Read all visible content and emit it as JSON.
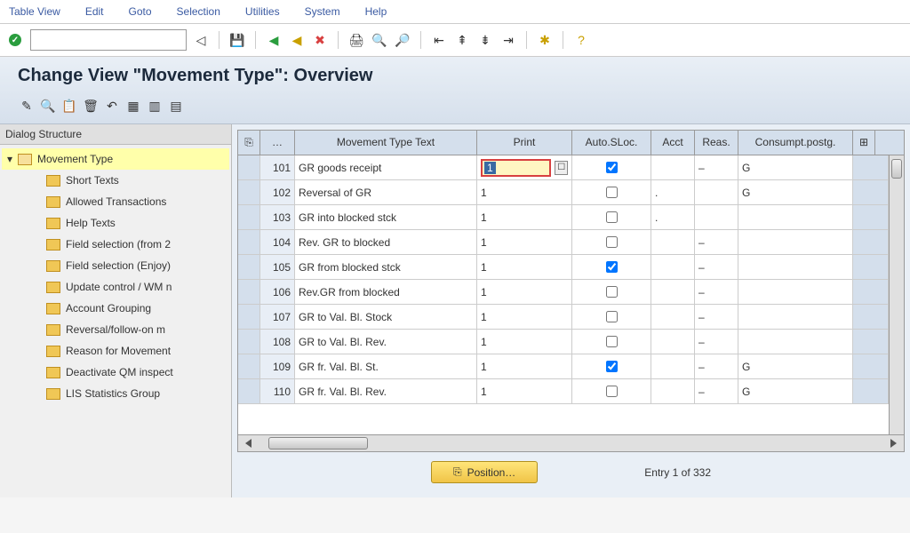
{
  "menu": [
    "Table View",
    "Edit",
    "Goto",
    "Selection",
    "Utilities",
    "System",
    "Help"
  ],
  "page_title": "Change View \"Movement Type\": Overview",
  "tree_header": "Dialog Structure",
  "tree": {
    "root": "Movement Type",
    "children": [
      "Short Texts",
      "Allowed Transactions",
      "Help Texts",
      "Field selection (from 2",
      "Field selection (Enjoy)",
      "Update control / WM n",
      "Account Grouping",
      "Reversal/follow-on m",
      "Reason for Movement",
      "Deactivate QM inspect",
      "LIS Statistics Group"
    ]
  },
  "table": {
    "headers": {
      "sel": "…",
      "text": "Movement Type Text",
      "print": "Print",
      "auto": "Auto.SLoc.",
      "acct": "Acct",
      "reas": "Reas.",
      "cons": "Consumpt.postg."
    },
    "rows": [
      {
        "code": "101",
        "text": "GR goods receipt",
        "print": "1",
        "auto": true,
        "acct": "",
        "reas": "–",
        "cons": "G",
        "edit": true
      },
      {
        "code": "102",
        "text": "Reversal of GR",
        "print": "1",
        "auto": false,
        "acct": ".",
        "reas": "",
        "cons": "G"
      },
      {
        "code": "103",
        "text": "GR into blocked stck",
        "print": "1",
        "auto": false,
        "acct": ".",
        "reas": "",
        "cons": ""
      },
      {
        "code": "104",
        "text": "Rev. GR to blocked",
        "print": "1",
        "auto": false,
        "acct": "",
        "reas": "–",
        "cons": ""
      },
      {
        "code": "105",
        "text": "GR from blocked stck",
        "print": "1",
        "auto": true,
        "acct": "",
        "reas": "–",
        "cons": ""
      },
      {
        "code": "106",
        "text": "Rev.GR from blocked",
        "print": "1",
        "auto": false,
        "acct": "",
        "reas": "–",
        "cons": ""
      },
      {
        "code": "107",
        "text": "GR to Val. Bl. Stock",
        "print": "1",
        "auto": false,
        "acct": "",
        "reas": "–",
        "cons": ""
      },
      {
        "code": "108",
        "text": "GR to Val. Bl. Rev.",
        "print": "1",
        "auto": false,
        "acct": "",
        "reas": "–",
        "cons": ""
      },
      {
        "code": "109",
        "text": "GR fr. Val. Bl. St.",
        "print": "1",
        "auto": true,
        "acct": "",
        "reas": "–",
        "cons": "G"
      },
      {
        "code": "110",
        "text": "GR fr. Val. Bl. Rev.",
        "print": "1",
        "auto": false,
        "acct": "",
        "reas": "–",
        "cons": "G"
      }
    ]
  },
  "position_btn": "Position…",
  "entry_label": "Entry 1 of 332"
}
